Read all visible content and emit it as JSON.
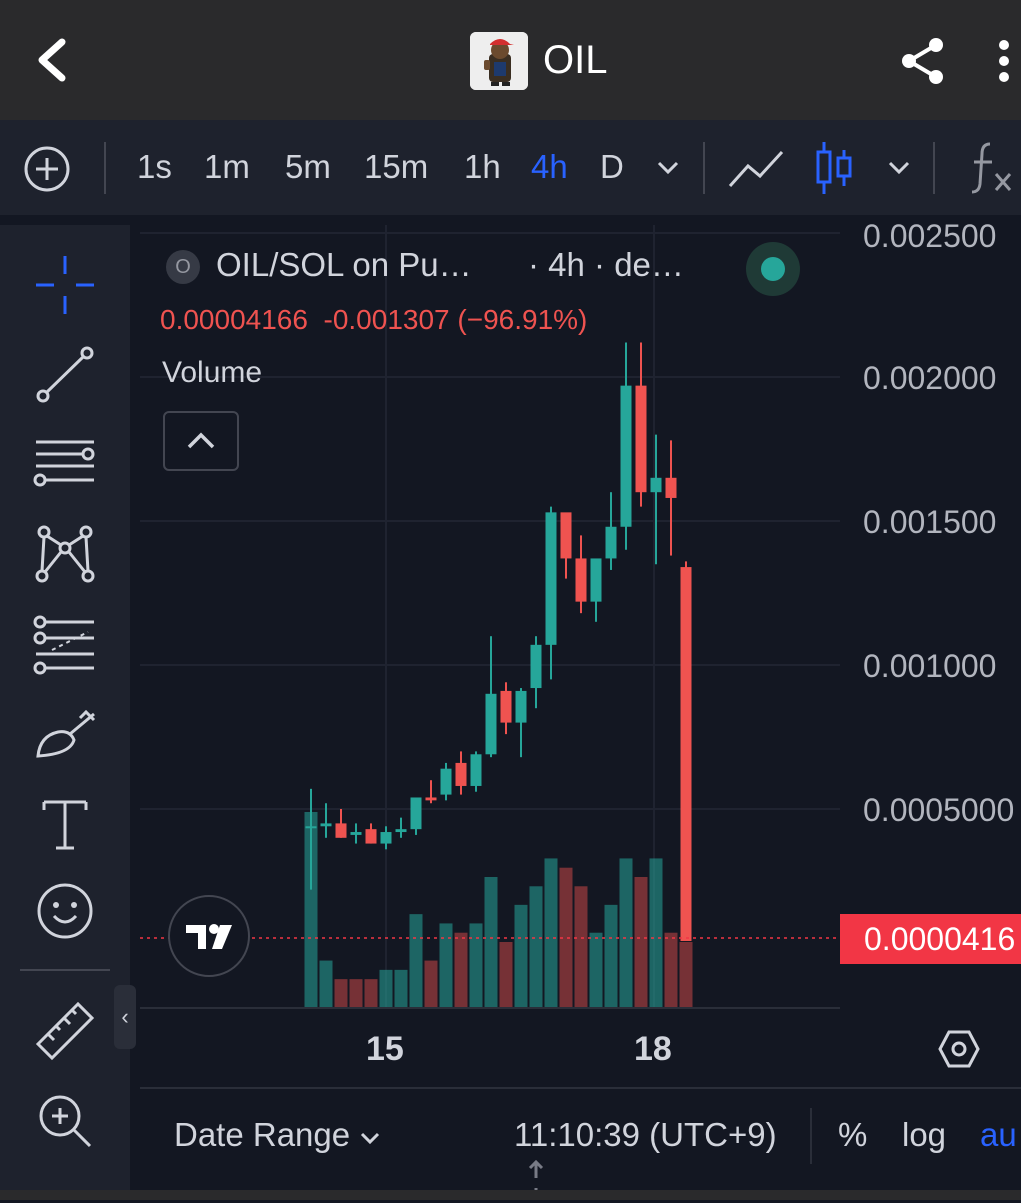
{
  "header": {
    "title": "OIL",
    "icons": [
      "back-arrow-icon",
      "token-logo",
      "share-icon",
      "more-vertical-icon"
    ]
  },
  "toolbar": {
    "intervals": [
      "1s",
      "1m",
      "5m",
      "15m",
      "1h",
      "4h",
      "D"
    ],
    "active_interval": "4h",
    "icons": [
      "add-icon",
      "chevron-down-icon",
      "line-chart-icon",
      "candlestick-icon",
      "chevron-down-icon",
      "indicators-fx-icon"
    ]
  },
  "tools": [
    "crosshair-icon",
    "trend-line-icon",
    "horizontal-lines-icon",
    "pattern-icon",
    "fib-icon",
    "brush-icon",
    "text-icon",
    "emoji-icon",
    "ruler-icon",
    "zoom-in-icon"
  ],
  "legend": {
    "symbol_letter": "O",
    "title": "OIL/SOL on Pu…",
    "interval_text": "· 4h · de…",
    "price": "0.00004166",
    "change": "-0.001307",
    "change_pct": "(−96.91%)",
    "volume_label": "Volume"
  },
  "yaxis": {
    "labels": [
      "0.002500",
      "0.002000",
      "0.001500",
      "0.001000",
      "0.0005000"
    ],
    "last_price": "0.0000416"
  },
  "xaxis": {
    "labels": [
      "15",
      "18"
    ]
  },
  "bottom": {
    "date_range": "Date Range",
    "time": "11:10:39 (UTC+9)",
    "percent": "%",
    "log": "log",
    "auto": "au"
  },
  "colors": {
    "up": "#26a69a",
    "down": "#ef5350",
    "accent": "#2962ff",
    "background": "#131722"
  },
  "chart_data": {
    "type": "candlestick",
    "title": "OIL/SOL",
    "interval": "4h",
    "ylim": [
      0,
      0.0025
    ],
    "candles": [
      {
        "o": 0.00044,
        "h": 0.00057,
        "l": 0.00022,
        "c": 0.00044
      },
      {
        "o": 0.00044,
        "h": 0.00052,
        "l": 0.0004,
        "c": 0.00045
      },
      {
        "o": 0.00045,
        "h": 0.0005,
        "l": 0.0004,
        "c": 0.0004
      },
      {
        "o": 0.00041,
        "h": 0.00045,
        "l": 0.00038,
        "c": 0.00042
      },
      {
        "o": 0.00043,
        "h": 0.00045,
        "l": 0.00038,
        "c": 0.00038
      },
      {
        "o": 0.00038,
        "h": 0.00044,
        "l": 0.00036,
        "c": 0.00042
      },
      {
        "o": 0.00042,
        "h": 0.00047,
        "l": 0.0004,
        "c": 0.00043
      },
      {
        "o": 0.00043,
        "h": 0.0005,
        "l": 0.00041,
        "c": 0.00054
      },
      {
        "o": 0.00054,
        "h": 0.0006,
        "l": 0.00052,
        "c": 0.00053
      },
      {
        "o": 0.00055,
        "h": 0.00066,
        "l": 0.00053,
        "c": 0.00064
      },
      {
        "o": 0.00066,
        "h": 0.0007,
        "l": 0.00055,
        "c": 0.00058
      },
      {
        "o": 0.00058,
        "h": 0.0007,
        "l": 0.00056,
        "c": 0.00069
      },
      {
        "o": 0.00069,
        "h": 0.0011,
        "l": 0.00068,
        "c": 0.0009
      },
      {
        "o": 0.00091,
        "h": 0.00094,
        "l": 0.00076,
        "c": 0.0008
      },
      {
        "o": 0.0008,
        "h": 0.00092,
        "l": 0.00068,
        "c": 0.00091
      },
      {
        "o": 0.00092,
        "h": 0.0011,
        "l": 0.00085,
        "c": 0.00107
      },
      {
        "o": 0.00107,
        "h": 0.00155,
        "l": 0.00095,
        "c": 0.00153
      },
      {
        "o": 0.00153,
        "h": 0.00152,
        "l": 0.0013,
        "c": 0.00137
      },
      {
        "o": 0.00137,
        "h": 0.00145,
        "l": 0.00118,
        "c": 0.00122
      },
      {
        "o": 0.00122,
        "h": 0.0013,
        "l": 0.00115,
        "c": 0.00137
      },
      {
        "o": 0.00137,
        "h": 0.0016,
        "l": 0.00133,
        "c": 0.00148
      },
      {
        "o": 0.00148,
        "h": 0.00212,
        "l": 0.0014,
        "c": 0.00197
      },
      {
        "o": 0.00197,
        "h": 0.00212,
        "l": 0.00155,
        "c": 0.0016
      },
      {
        "o": 0.0016,
        "h": 0.0018,
        "l": 0.00135,
        "c": 0.00165
      },
      {
        "o": 0.00165,
        "h": 0.00178,
        "l": 0.00138,
        "c": 0.00158
      },
      {
        "o": 0.00134,
        "h": 0.00136,
        "l": 4.16e-05,
        "c": 4.16e-05
      }
    ],
    "volume": [
      21,
      5,
      3,
      3,
      3,
      4,
      4,
      10,
      5,
      9,
      8,
      9,
      14,
      7,
      11,
      13,
      16,
      15,
      13,
      8,
      11,
      16,
      14,
      16,
      8,
      7
    ],
    "volume_dir": [
      "up",
      "up",
      "down",
      "down",
      "down",
      "up",
      "up",
      "up",
      "down",
      "up",
      "down",
      "up",
      "up",
      "down",
      "up",
      "up",
      "up",
      "down",
      "down",
      "up",
      "up",
      "up",
      "down",
      "up",
      "down",
      "down"
    ],
    "last_price": 4.166e-05,
    "x_ticks": [
      "15",
      "18"
    ]
  }
}
